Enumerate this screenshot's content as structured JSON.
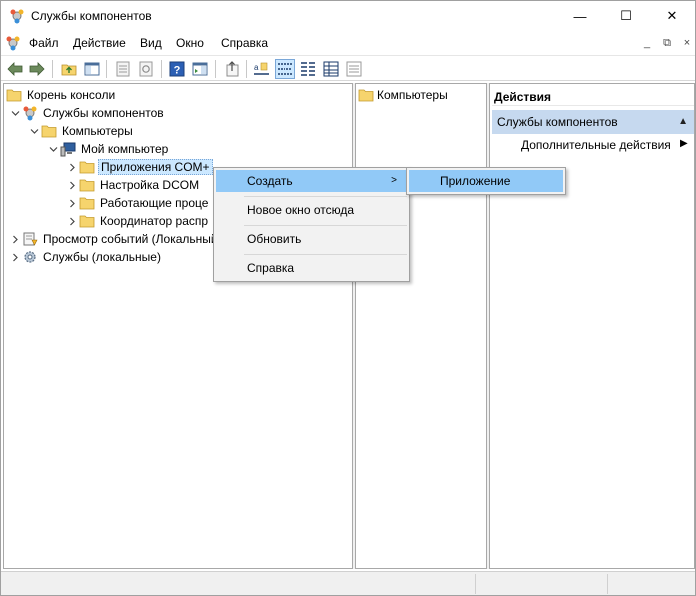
{
  "window": {
    "title": "Службы компонентов"
  },
  "titlebar": {
    "minimize": "—",
    "maximize": "☐",
    "close": "✕"
  },
  "menubar": {
    "items": [
      "Файл",
      "Действие",
      "Вид",
      "Окно",
      "Справка"
    ],
    "mdi": {
      "minimize": "_",
      "restore": "⧉",
      "close": "×"
    }
  },
  "tree": {
    "items": [
      {
        "label": "Корень консоли",
        "icon": "folder-icon"
      },
      {
        "label": "Службы компонентов",
        "icon": "component-services-icon"
      },
      {
        "label": "Компьютеры",
        "icon": "folder-icon"
      },
      {
        "label": "Мой компьютер",
        "icon": "computer-icon"
      },
      {
        "label": "Приложения COM+",
        "icon": "folder-icon"
      },
      {
        "label": "Настройка DCOM",
        "icon": "folder-icon"
      },
      {
        "label": "Работающие проце",
        "icon": "folder-icon"
      },
      {
        "label": "Координатор распр",
        "icon": "folder-icon"
      },
      {
        "label": "Просмотр событий (Локальный",
        "icon": "event-viewer-icon"
      },
      {
        "label": "Службы (локальные)",
        "icon": "services-gear-icon"
      }
    ]
  },
  "list": {
    "items": [
      {
        "label": "Компьютеры",
        "icon": "folder-icon"
      }
    ]
  },
  "actions": {
    "header": "Действия",
    "section": "Службы компонентов",
    "items": [
      {
        "label": "Дополнительные действия"
      }
    ]
  },
  "context_menu": {
    "items": [
      "Создать",
      "Новое окно отсюда",
      "Обновить",
      "Справка"
    ],
    "submenu": [
      "Приложение"
    ]
  },
  "colors": {
    "highlight": "#91c9f7",
    "selection": "#cce8ff",
    "action_section": "#c6d9ef",
    "folder": "#f6d46d"
  }
}
